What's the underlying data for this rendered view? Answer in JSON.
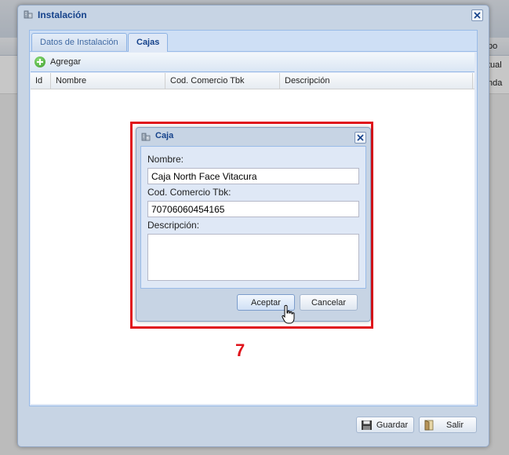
{
  "background": {
    "right_col_header": "po",
    "rows": [
      "tual",
      "nda"
    ]
  },
  "window": {
    "title": "Instalación",
    "close_icon": "close-x-icon",
    "tabs": [
      {
        "label": "Datos de Instalación",
        "active": false
      },
      {
        "label": "Cajas",
        "active": true
      }
    ],
    "toolbar": {
      "add_label": "Agregar",
      "add_icon": "plus-circle-icon"
    },
    "grid": {
      "columns": [
        "Id",
        "Nombre",
        "Cod. Comercio Tbk",
        "Descripción"
      ],
      "rows": []
    },
    "footer": {
      "save_label": "Guardar",
      "exit_label": "Salir"
    }
  },
  "dialog": {
    "title": "Caja",
    "fields": {
      "nombre_label": "Nombre:",
      "nombre_value": "Caja North Face Vitacura",
      "codigo_label": "Cod. Comercio Tbk:",
      "codigo_value": "70706060454165",
      "descripcion_label": "Descripción:",
      "descripcion_value": ""
    },
    "accept_label": "Aceptar",
    "cancel_label": "Cancelar"
  },
  "annotation": {
    "step_number": "7",
    "color": "#e0131b"
  },
  "colors": {
    "title_text": "#15428b",
    "panel_bg": "#dfe8f6",
    "window_bg": "#c7d4e4"
  }
}
